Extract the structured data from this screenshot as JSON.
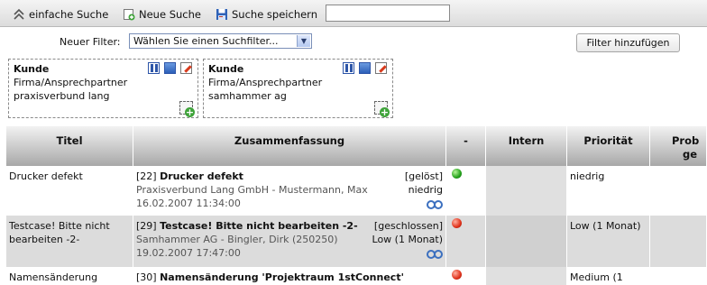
{
  "toolbar": {
    "simple_search": "einfache Suche",
    "new_search": "Neue Suche",
    "save_search": "Suche speichern",
    "search_value": ""
  },
  "filter": {
    "label": "Neuer Filter:",
    "select_value": "Wählen Sie einen Suchfilter...",
    "add_button": "Filter hinzufügen"
  },
  "filter_boxes": [
    {
      "title": "Kunde",
      "field": "Firma/Ansprechpartner",
      "value": "praxisverbund lang"
    },
    {
      "title": "Kunde",
      "field": "Firma/Ansprechpartner",
      "value": "samhammer ag"
    }
  ],
  "table": {
    "headers": [
      "Titel",
      "Zusammenfassung",
      "-",
      "Intern",
      "Priorität",
      "Prob",
      "ge"
    ],
    "rows": [
      {
        "title": "Drucker defekt",
        "summary_id_title": "Drucker defekt",
        "summary_id": "[22]",
        "summary_status": "[gelöst]",
        "summary_company": "Praxisverbund Lang GmbH - Mustermann, Max",
        "summary_priority": "niedrig",
        "summary_date": "16.02.2007 11:34:00",
        "status_color": "green",
        "intern": "",
        "priority": "niedrig"
      },
      {
        "title": "Testcase! Bitte nicht bearbeiten -2-",
        "summary_id_title": "Testcase! Bitte nicht bearbeiten -2-",
        "summary_id": "[29]",
        "summary_status": "[geschlossen]",
        "summary_company": "Samhammer AG - Bingler, Dirk (250250)",
        "summary_priority": "Low (1 Monat)",
        "summary_date": "19.02.2007 17:47:00",
        "status_color": "red",
        "intern": "",
        "priority": "Low (1 Monat)"
      },
      {
        "title": "Namensänderung",
        "summary_id": "[30]",
        "summary_id_title": "Namensänderung 'Projektraum 1stConnect'",
        "status_color": "red",
        "priority": "Medium (1"
      }
    ]
  },
  "colors": {
    "row_alt": "#dcdcdc",
    "row_plain": "#ffffff",
    "accent_blue": "#2d55a8"
  }
}
